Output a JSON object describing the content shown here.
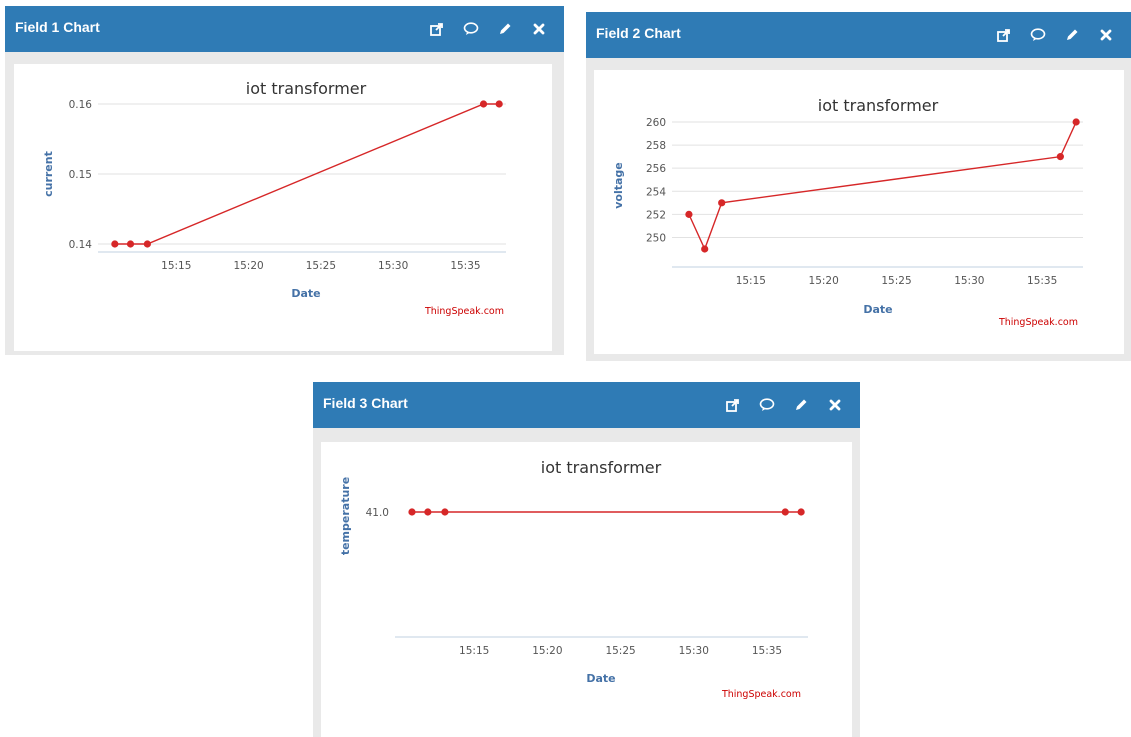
{
  "theme": {
    "header_color": "#2f7bb5",
    "series_color": "#d62728",
    "grid_color": "#e2e2e2",
    "axis_title_color": "#4572a7"
  },
  "icons": [
    "external-link-icon",
    "comment-icon",
    "pencil-icon",
    "close-icon"
  ],
  "panels": [
    {
      "title": "Field 1 Chart"
    },
    {
      "title": "Field 2 Chart"
    },
    {
      "title": "Field 3 Chart"
    }
  ],
  "chart_data": [
    {
      "type": "line",
      "title": "iot transformer",
      "xlabel": "Date",
      "ylabel": "current",
      "credit": "ThingSpeak.com",
      "x_ticks": [
        "15:15",
        "15:20",
        "15:25",
        "15:30",
        "15:35"
      ],
      "y_ticks": [
        "0.14",
        "0.15",
        "0.16"
      ],
      "ylim": [
        0.14,
        0.16
      ],
      "grid": true,
      "series": [
        {
          "x": [
            "15:10:45",
            "15:11:50",
            "15:13:00",
            "15:36:15",
            "15:37:20"
          ],
          "values": [
            0.14,
            0.14,
            0.14,
            0.16,
            0.16
          ]
        }
      ]
    },
    {
      "type": "line",
      "title": "iot transformer",
      "xlabel": "Date",
      "ylabel": "voltage",
      "credit": "ThingSpeak.com",
      "x_ticks": [
        "15:15",
        "15:20",
        "15:25",
        "15:30",
        "15:35"
      ],
      "y_ticks": [
        "250",
        "252",
        "254",
        "256",
        "258",
        "260"
      ],
      "ylim": [
        249,
        260
      ],
      "grid": true,
      "series": [
        {
          "x": [
            "15:10:45",
            "15:11:50",
            "15:13:00",
            "15:36:15",
            "15:37:20"
          ],
          "values": [
            252,
            249,
            253,
            257,
            260
          ]
        }
      ]
    },
    {
      "type": "line",
      "title": "iot transformer",
      "xlabel": "Date",
      "ylabel": "temperature",
      "credit": "ThingSpeak.com",
      "x_ticks": [
        "15:15",
        "15:20",
        "15:25",
        "15:30",
        "15:35"
      ],
      "y_ticks": [
        "41.0"
      ],
      "ylim": [
        41.0,
        41.0
      ],
      "grid": false,
      "series": [
        {
          "x": [
            "15:10:45",
            "15:11:50",
            "15:13:00",
            "15:36:15",
            "15:37:20"
          ],
          "values": [
            41.0,
            41.0,
            41.0,
            41.0,
            41.0
          ]
        }
      ]
    }
  ]
}
